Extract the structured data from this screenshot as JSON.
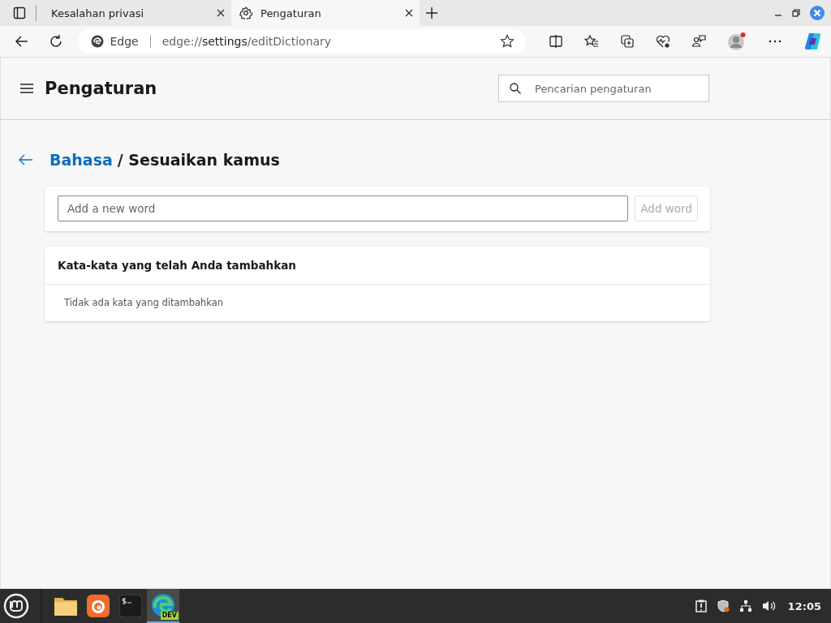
{
  "tabs": [
    {
      "title": "Kesalahan privasi",
      "kind": "page",
      "selected": false
    },
    {
      "title": "Pengaturan",
      "kind": "settings",
      "selected": true
    }
  ],
  "address_bar": {
    "site_label": "Edge",
    "url_scheme": "edge://",
    "url_host": "settings",
    "url_path": "/editDictionary"
  },
  "settings": {
    "title": "Pengaturan",
    "search": {
      "placeholder": "Pencarian pengaturan"
    }
  },
  "breadcrumb": {
    "parent": "Bahasa",
    "current": "/ Sesuaikan kamus"
  },
  "add_word": {
    "placeholder": "Add a new word",
    "button": "Add word",
    "disabled": true
  },
  "words_card": {
    "heading": "Kata-kata yang telah Anda tambahkan",
    "empty_message": "Tidak ada kata yang ditambahkan"
  },
  "taskbar": {
    "apps": [
      {
        "kind": "files",
        "selected": false
      },
      {
        "kind": "firefox",
        "selected": false
      },
      {
        "kind": "terminal",
        "selected": false
      },
      {
        "kind": "edge",
        "badge": "DEV",
        "selected": true
      }
    ],
    "clock": "12:05"
  }
}
